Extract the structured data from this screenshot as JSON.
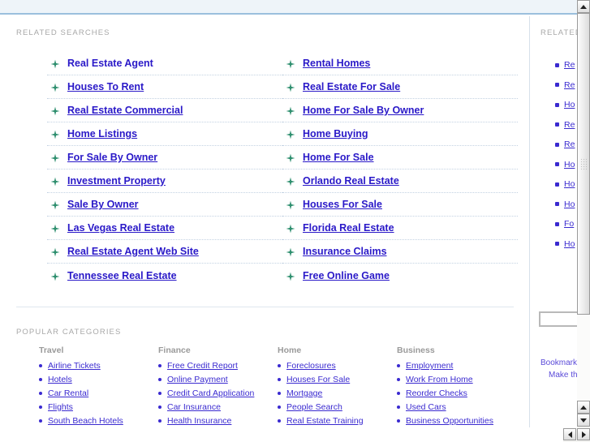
{
  "related": {
    "heading": "RELATED SEARCHES",
    "links_left": [
      "Real Estate Agent",
      "Houses To Rent",
      "Real Estate Commercial",
      "Home Listings",
      "For Sale By Owner",
      "Investment Property",
      "Sale By Owner",
      "Las Vegas Real Estate",
      "Real Estate Agent Web Site",
      "Tennessee Real Estate"
    ],
    "links_right": [
      "Rental Homes",
      "Real Estate For Sale",
      "Home For Sale By Owner",
      "Home Buying",
      "Home For Sale",
      "Orlando Real Estate",
      "Houses For Sale",
      "Florida Real Estate",
      "Insurance Claims",
      "Free Online Game"
    ]
  },
  "categories": {
    "heading": "POPULAR CATEGORIES",
    "columns": [
      {
        "title": "Travel",
        "items": [
          "Airline Tickets",
          "Hotels",
          "Car Rental",
          "Flights",
          "South Beach Hotels"
        ]
      },
      {
        "title": "Finance",
        "items": [
          "Free Credit Report",
          "Online Payment",
          "Credit Card Application",
          "Car Insurance",
          "Health Insurance"
        ]
      },
      {
        "title": "Home",
        "items": [
          "Foreclosures",
          "Houses For Sale",
          "Mortgage",
          "People Search",
          "Real Estate Training"
        ]
      },
      {
        "title": "Business",
        "items": [
          "Employment",
          "Work From Home",
          "Reorder Checks",
          "Used Cars",
          "Business Opportunities"
        ]
      }
    ]
  },
  "sidebar": {
    "heading": "RELATED",
    "links": [
      "Re",
      "Re",
      "Ho",
      "Re",
      "Re",
      "Ho",
      "Ho",
      "Ho",
      "Fo",
      "Ho"
    ],
    "search_value": "",
    "search_placeholder": "",
    "footer_links": [
      "Bookmark",
      "Make this"
    ]
  },
  "colors": {
    "link": "#2a19c8",
    "sidebar_link": "#3a2ad0",
    "heading": "#a8a8a8",
    "banner": "#eef4f9",
    "banner_border": "#9bbfdd",
    "bullet_sparkle": "#2f8f6f",
    "row_separator": "#c3d2e2"
  }
}
